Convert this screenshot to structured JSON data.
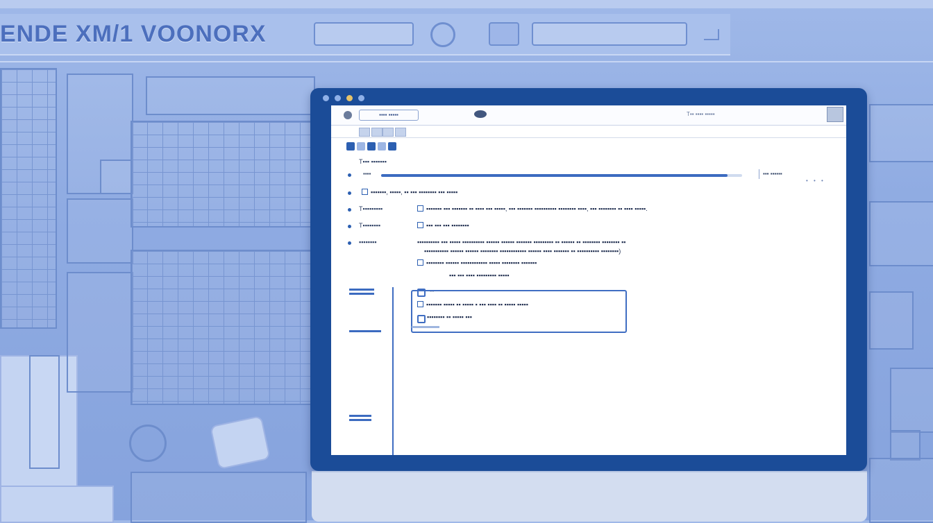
{
  "background": {
    "header_title": "ENDE XM/1 VOONORX"
  },
  "window": {
    "address_label": "▪▪▪▪ ▪▪▪▪▪",
    "toolbar_right_text": "T▪▪ ▪▪▪▪ ▪▪▪▪▪",
    "section_label": "T▪▪▪ ▪▪▪▪▪▪▪",
    "progress": {
      "label": "▪▪▪▪",
      "value_fraction": 0.96,
      "meta": "▪▪▪ ▪▪▪▪▪▪"
    },
    "rows": [
      {
        "key": "",
        "value": "▪▪▪▪▪▪▪, ▪▪▪▪▪, ▪▪ ▪▪▪ ▪▪▪▪▪▪▪▪ ▪▪▪ ▪▪▪▪▪"
      },
      {
        "key": "T▪▪▪▪▪▪▪▪▪",
        "value": "▪▪▪▪▪▪▪ ▪▪▪ ▪▪▪▪▪▪▪ ▪▪ ▪▪▪▪ ▪▪▪ ▪▪▪▪▪, ▪▪▪ ▪▪▪▪▪▪▪ ▪▪▪▪▪▪▪▪▪▪ ▪▪▪▪▪▪▪▪ ▪▪▪▪, ▪▪▪ ▪▪▪▪▪▪▪▪ ▪▪ ▪▪▪▪ ▪▪▪▪▪."
      },
      {
        "key": "T▪▪▪▪▪▪▪▪",
        "value": "▪▪▪ ▪▪▪ ▪▪▪ ▪▪▪▪▪▪▪▪"
      },
      {
        "key": "▪▪▪▪▪▪▪▪",
        "value": "▪▪▪▪▪▪▪▪▪▪ ▪▪▪ ▪▪▪▪▪ ▪▪▪▪▪▪▪▪▪▪ ▪▪▪▪▪▪ ▪▪▪▪▪▪ ▪▪▪▪▪▪▪ ▪▪▪▪▪▪▪▪▪ ▪▪ ▪▪▪▪▪▪ ▪▪ ▪▪▪▪▪▪▪▪ ▪▪▪▪▪▪▪▪ ▪▪",
        "value2": "▪▪▪▪▪▪▪▪▪▪▪ ▪▪▪▪▪▪ ▪▪▪▪▪▪ ▪▪▪▪▪▪▪▪ ▪▪▪▪▪▪▪▪▪▪▪▪ ▪▪▪▪▪▪ ▪▪▪▪ ▪▪▪▪▪▪▪ ▪▪ ▪▪▪▪▪▪▪▪▪▪ ▪▪▪▪▪▪▪▪)"
      }
    ],
    "sub_rows": [
      "▪▪▪▪▪▪▪▪ ▪▪▪▪▪▪ ▪▪▪▪▪▪▪▪▪▪▪▪ ▪▪▪▪▪ ▪▪▪▪▪▪▪▪ ▪▪▪▪▪▪▪",
      "▪▪▪ ▪▪▪ ▪▪▪▪ ▪▪▪▪▪▪▪▪▪ ▪▪▪▪▪",
      "▪▪"
    ],
    "box_rows": [
      "▪▪▪▪▪▪▪ ▪▪▪▪▪ ▪▪ ▪▪▪▪▪ ▪ ▪▪▪ ▪▪▪▪ ▪▪ ▪▪▪▪▪ ▪▪▪▪▪",
      "▪▪▪▪▪▪▪▪ ▪▪ ▪▪▪▪▪ ▪▪▪"
    ]
  },
  "colors": {
    "monitor_frame": "#1b4c98",
    "accent": "#3f6dc2",
    "background": "#8fabe2"
  }
}
